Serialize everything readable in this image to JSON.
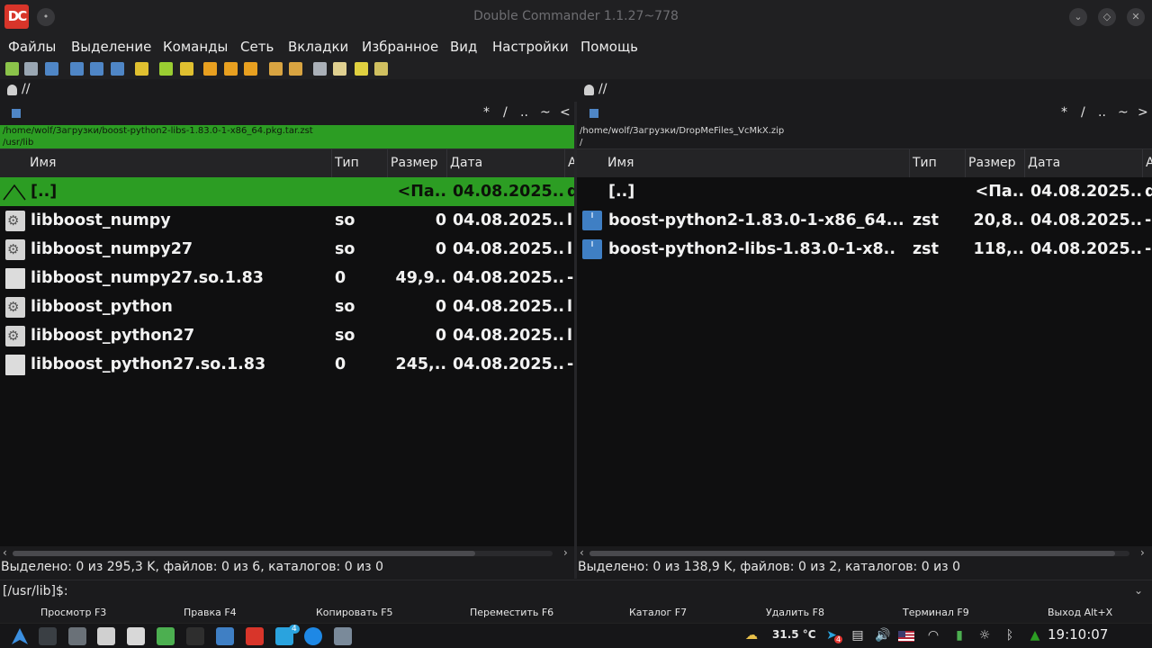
{
  "window": {
    "title": "Double Commander 1.1.27~778",
    "logo_text": "DC",
    "controls": [
      "minimize",
      "maximize",
      "close"
    ]
  },
  "menu": {
    "items": [
      "Файлы",
      "Выделение",
      "Команды",
      "Сеть",
      "Вкладки",
      "Избранное",
      "Вид",
      "Настройки",
      "Помощь"
    ]
  },
  "toolbar": {
    "icons": [
      "refresh-icon",
      "terminal-icon",
      "options-icon",
      "brief-view-icon",
      "full-view-icon",
      "thumb-view-icon",
      "sync-dirs-icon",
      "copy-path-left-icon",
      "copy-path-right-icon",
      "multi-rename-icon",
      "search-icon",
      "advanced-search-icon",
      "pack-icon",
      "unpack-icon",
      "compare-icon",
      "edit-icon",
      "view-icon",
      "copy-names-icon"
    ],
    "colors": [
      "#8bc34a",
      "#9aa7b3",
      "#4f86c6",
      "#4f86c6",
      "#4f86c6",
      "#4f86c6",
      "#e0c030",
      "#9acd32",
      "#e0c030",
      "#e8a020",
      "#e8a020",
      "#e8a020",
      "#d9a441",
      "#d9a441",
      "#aab0b8",
      "#e0d090",
      "#e0d040",
      "#d0c060"
    ]
  },
  "left_panel": {
    "drive": "//",
    "nav": [
      "*",
      "/",
      "..",
      "~",
      "<"
    ],
    "path_top": "/home/wolf/Загрузки/boost-python2-libs-1.83.0-1-x86_64.pkg.tar.zst",
    "path_current": "/usr/lib",
    "columns": {
      "name": "Имя",
      "type": "Тип",
      "size": "Размер",
      "date": "Дата",
      "attr": "А"
    },
    "rows": [
      {
        "name": "[..]",
        "type": "",
        "size": "<Па..",
        "date": "04.08.2025..",
        "attr": "d",
        "icon": "up",
        "selected": true
      },
      {
        "name": "libboost_numpy",
        "type": "so",
        "size": "0",
        "date": "04.08.2025..",
        "attr": "l",
        "icon": "gear",
        "selected": false
      },
      {
        "name": "libboost_numpy27",
        "type": "so",
        "size": "0",
        "date": "04.08.2025..",
        "attr": "l",
        "icon": "gear",
        "selected": false
      },
      {
        "name": "libboost_numpy27.so.1.83",
        "type": "0",
        "size": "49,9..",
        "date": "04.08.2025..",
        "attr": "-",
        "icon": "doc",
        "selected": false
      },
      {
        "name": "libboost_python",
        "type": "so",
        "size": "0",
        "date": "04.08.2025..",
        "attr": "l",
        "icon": "gear",
        "selected": false
      },
      {
        "name": "libboost_python27",
        "type": "so",
        "size": "0",
        "date": "04.08.2025..",
        "attr": "l",
        "icon": "gear",
        "selected": false
      },
      {
        "name": "libboost_python27.so.1.83",
        "type": "0",
        "size": "245,..",
        "date": "04.08.2025..",
        "attr": "-",
        "icon": "doc",
        "selected": false
      }
    ],
    "status": "Выделено: 0 из 295,3 K, файлов: 0 из 6, каталогов: 0 из 0"
  },
  "right_panel": {
    "drive": "//",
    "nav": [
      "*",
      "/",
      "..",
      "~",
      ">"
    ],
    "path_top": "/home/wolf/Загрузки/DropMeFiles_VcMkX.zip",
    "path_current": "/",
    "columns": {
      "name": "Имя",
      "type": "Тип",
      "size": "Размер",
      "date": "Дата",
      "attr": "А"
    },
    "rows": [
      {
        "name": "[..]",
        "type": "",
        "size": "<Па..",
        "date": "04.08.2025..",
        "attr": "d",
        "icon": "none",
        "selected": false
      },
      {
        "name": "boost-python2-1.83.0-1-x86_64...",
        "type": "zst",
        "size": "20,8..",
        "date": "04.08.2025..",
        "attr": "-",
        "icon": "zst",
        "selected": false
      },
      {
        "name": "boost-python2-libs-1.83.0-1-x8..",
        "type": "zst",
        "size": "118,..",
        "date": "04.08.2025..",
        "attr": "-",
        "icon": "zst",
        "selected": false
      }
    ],
    "status": "Выделено: 0 из 138,9 K, файлов: 0 из 2, каталогов: 0 из 0"
  },
  "command_line": {
    "prompt": "[/usr/lib]$:",
    "value": ""
  },
  "function_keys": [
    {
      "label": "Просмотр F3"
    },
    {
      "label": "Правка F4"
    },
    {
      "label": "Копировать F5"
    },
    {
      "label": "Переместить F6"
    },
    {
      "label": "Каталог F7"
    },
    {
      "label": "Удалить F8"
    },
    {
      "label": "Терминал F9"
    },
    {
      "label": "Выход Alt+X"
    }
  ],
  "taskbar": {
    "apps": [
      "arch-launcher-icon",
      "system-monitor-icon",
      "calculator-icon",
      "tools-icon",
      "text-editor-icon",
      "download-manager-icon",
      "terminal-icon",
      "file-manager-icon",
      "double-commander-icon",
      "telegram-icon",
      "chromium-icon",
      "screenshot-icon"
    ],
    "app_colors": [
      "#3b8fe0",
      "#3a3f44",
      "#6a7178",
      "#d0d0d0",
      "#d8d8d8",
      "#4caf50",
      "#2e2e2e",
      "#3f7fc4",
      "#d8352a",
      "#2aa3de",
      "#1e88e5",
      "#7a8a9a"
    ],
    "telegram_badge": "4",
    "weather": "31.5 °C",
    "tray_icons": [
      "weather-icon",
      "telegram-tray-icon",
      "clipboard-icon",
      "volume-icon",
      "us-flag-icon",
      "wifi-icon",
      "battery-icon",
      "brightness-icon",
      "bluetooth-icon",
      "network-icon"
    ],
    "tray_badge": "4",
    "clock": "19:10:07"
  }
}
